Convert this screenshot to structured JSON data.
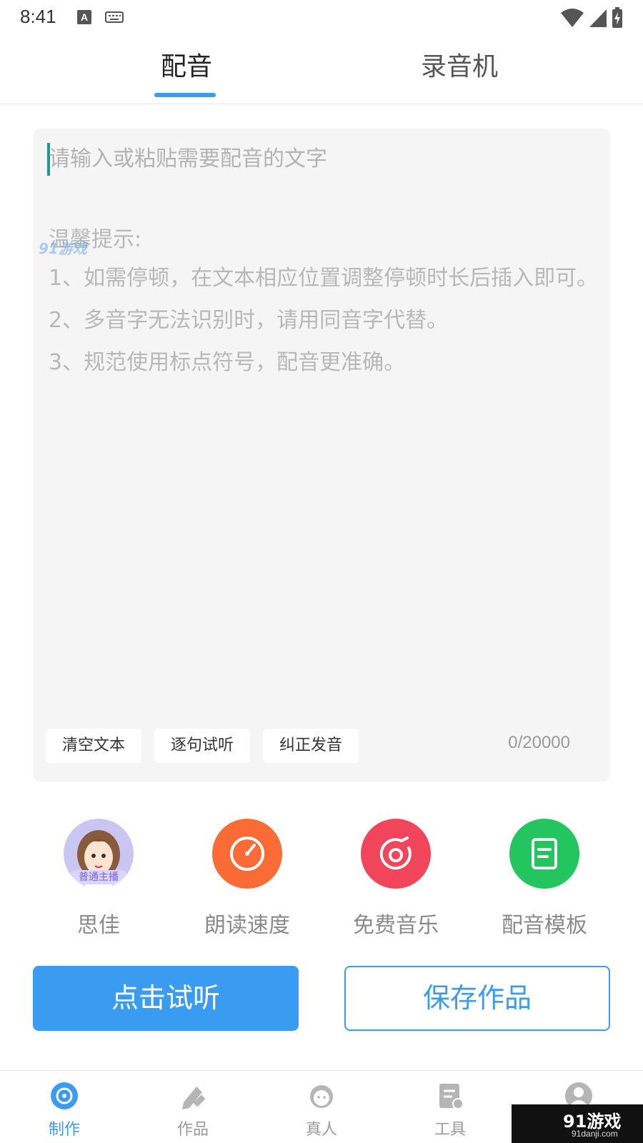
{
  "status": {
    "time": "8:41",
    "badge": "A"
  },
  "top_tabs": [
    {
      "label": "配音",
      "active": true
    },
    {
      "label": "录音机",
      "active": false
    }
  ],
  "editor": {
    "placeholder": "请输入或粘贴需要配音的文字",
    "tips_title": "温馨提示:",
    "tips": [
      "1、如需停顿，在文本相应位置调整停顿时长后插入即可。",
      "2、多音字无法识别时，请用同音字代替。",
      "3、规范使用标点符号，配音更准确。"
    ],
    "buttons": {
      "clear": "清空文本",
      "sentence": "逐句试听",
      "correct": "纠正发音"
    },
    "char_count": "0/20000"
  },
  "watermark": {
    "top_text": "91游戏",
    "top_sub": "91danji.com",
    "corner_brand": "91游戏",
    "corner_domain": "91danji.com"
  },
  "features": [
    {
      "label": "思佳",
      "icon": "avatar",
      "badge": "普通主播"
    },
    {
      "label": "朗读速度",
      "icon": "speedometer-icon"
    },
    {
      "label": "免费音乐",
      "icon": "music-disc-icon"
    },
    {
      "label": "配音模板",
      "icon": "document-icon"
    }
  ],
  "actions": {
    "listen": "点击试听",
    "save": "保存作品"
  },
  "bottom_nav": [
    {
      "label": "制作",
      "active": true
    },
    {
      "label": "作品",
      "active": false
    },
    {
      "label": "真人",
      "active": false
    },
    {
      "label": "工具",
      "active": false
    },
    {
      "label": "",
      "active": false
    }
  ],
  "colors": {
    "accent": "#3a9cf0",
    "speed": "#fb6b35",
    "music": "#f0455a",
    "template": "#22c55e",
    "avatar_bg": "#c9c6f2"
  }
}
